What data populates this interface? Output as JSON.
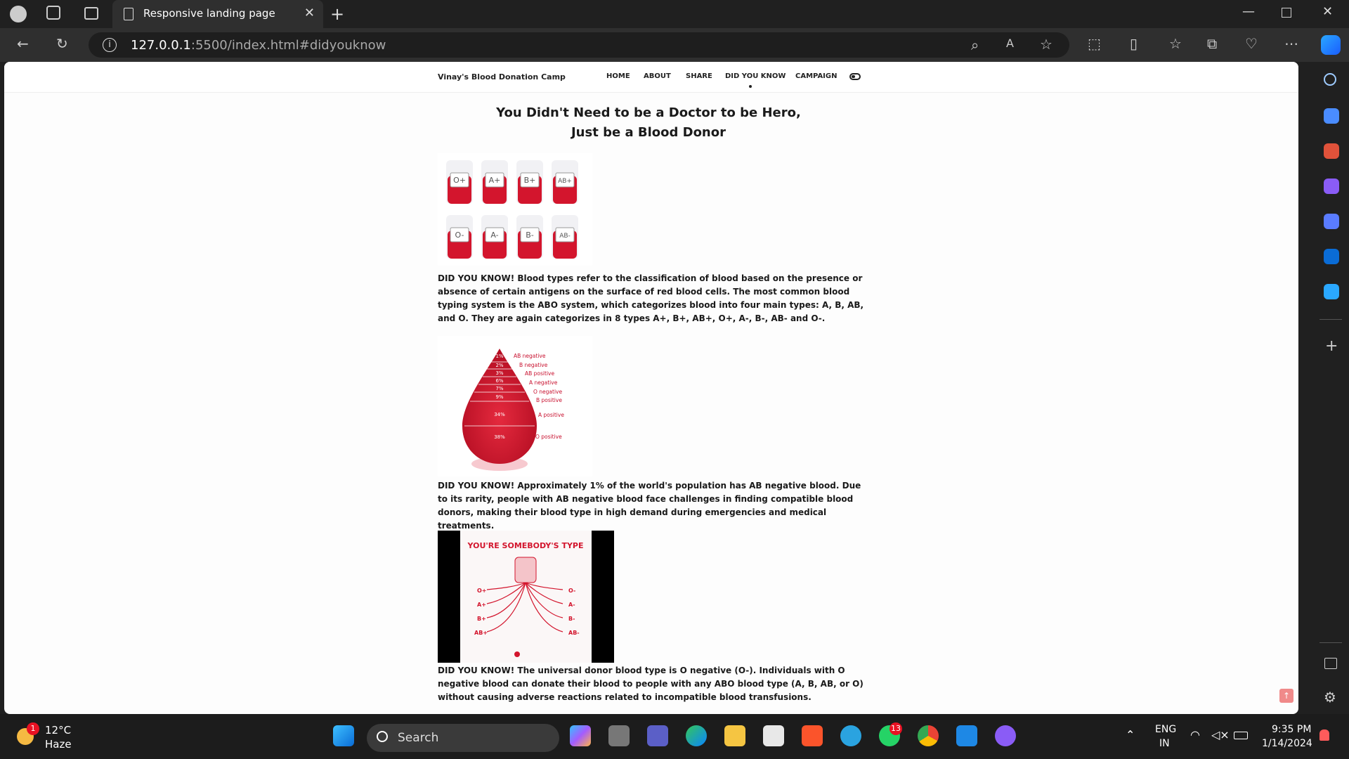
{
  "browser": {
    "tab_title": "Responsive landing page",
    "url_host": "127.0.0.1",
    "url_rest": ":5500/index.html#didyouknow"
  },
  "site": {
    "brand": "Vinay's Blood Donation Camp",
    "nav": [
      "HOME",
      "ABOUT",
      "SHARE",
      "DID YOU KNOW",
      "CAMPAIGN"
    ],
    "active_nav": "DID YOU KNOW",
    "heading_line1": "You Didn't Need to be a Doctor to be Hero,",
    "heading_line2": "Just be a Blood Donor",
    "blood_types_top": [
      "O+",
      "A+",
      "B+",
      "AB+"
    ],
    "blood_types_bottom": [
      "O-",
      "A-",
      "B-",
      "AB-"
    ],
    "para1": "DID YOU KNOW! Blood types refer to the classification of blood based on the presence or absence of certain antigens on the surface of red blood cells. The most common blood typing system is the ABO system, which categorizes blood into four main types: A, B, AB, and O. They are again categorizes in 8 types A+, B+, AB+, O+, A-, B-, AB- and O-.",
    "drop_rows": [
      {
        "pct": "1%",
        "label": "AB negative"
      },
      {
        "pct": "2%",
        "label": "B negative"
      },
      {
        "pct": "3%",
        "label": "AB positive"
      },
      {
        "pct": "6%",
        "label": "A negative"
      },
      {
        "pct": "7%",
        "label": "O negative"
      },
      {
        "pct": "9%",
        "label": "B positive"
      },
      {
        "pct": "34%",
        "label": "A positive"
      },
      {
        "pct": "38%",
        "label": "O positive"
      }
    ],
    "para2": "DID YOU KNOW! Approximately 1% of the world's population has AB negative blood. Due to its rarity, people with AB negative blood face challenges in finding compatible blood donors, making their blood type in high demand during emergencies and medical treatments.",
    "type_image_title": "YOU'RE SOMEBODY'S TYPE",
    "type_left": [
      "O+",
      "A+",
      "B+",
      "AB+"
    ],
    "type_right": [
      "O-",
      "A-",
      "B-",
      "AB-"
    ],
    "para3": "DID YOU KNOW! The universal donor blood type is O negative (O-). Individuals with O negative blood can donate their blood to people with any ABO blood type (A, B, AB, or O) without causing adverse reactions related to incompatible blood transfusions."
  },
  "taskbar": {
    "weather_temp": "12°C",
    "weather_desc": "Haze",
    "weather_badge": "1",
    "search_placeholder": "Search",
    "whatsapp_badge": "13",
    "lang_line1": "ENG",
    "lang_line2": "IN",
    "time": "9:35 PM",
    "date": "1/14/2024"
  },
  "colors": {
    "blood_red": "#d3152d",
    "accent_blue": "#0078d4"
  }
}
